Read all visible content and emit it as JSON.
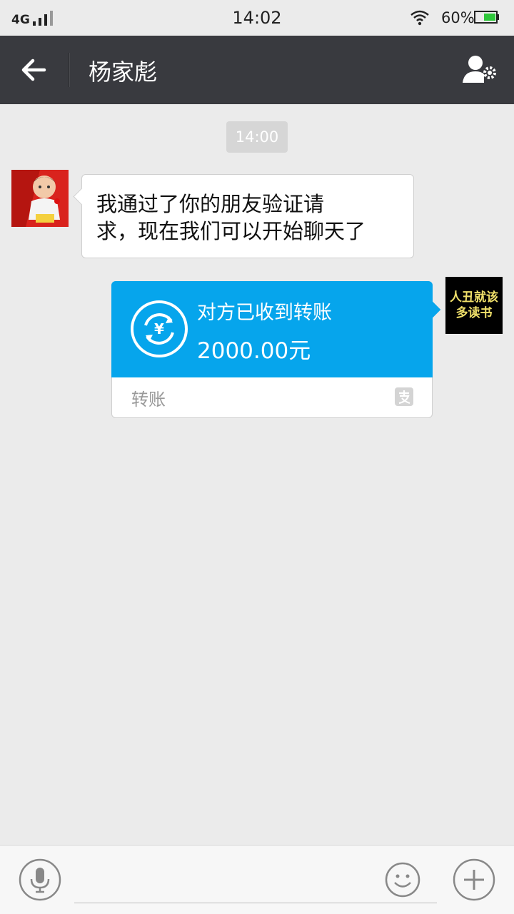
{
  "status_bar": {
    "network": "4G",
    "time": "14:02",
    "battery_percent": "60%",
    "battery_level": 0.6
  },
  "header": {
    "title": "杨家彪",
    "back_icon": "arrow-left-icon",
    "settings_icon": "contact-settings-icon",
    "background": "#393a3f"
  },
  "chat": {
    "time_label": "14:00",
    "messages": [
      {
        "side": "left",
        "text_line1": "我通过了你的朋友验证请",
        "text_line2": "求，现在我们可以开始聊天了"
      }
    ],
    "right_avatar_text_line1": "人丑就该",
    "right_avatar_text_line2": "多读书",
    "transfer": {
      "status": "对方已收到转账",
      "amount": "2000.00元",
      "label": "转账",
      "accent": "#06a5ec"
    }
  },
  "bottom_bar": {
    "voice_icon": "microphone-icon",
    "emoji_icon": "smiley-icon",
    "more_icon": "plus-icon",
    "input_placeholder": ""
  }
}
